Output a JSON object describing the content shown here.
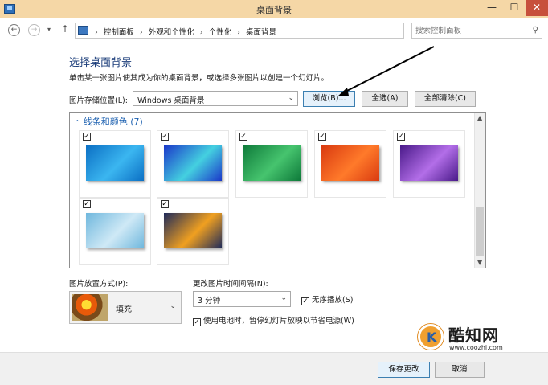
{
  "window": {
    "title": "桌面背景",
    "minimize_glyph": "—",
    "maximize_glyph": "☐",
    "close_glyph": "✕"
  },
  "nav": {
    "back_icon": "left-arrow-icon",
    "forward_icon": "right-arrow-icon",
    "down_glyph": "▾",
    "up_glyph": "↑",
    "breadcrumbs": [
      "控制面板",
      "外观和个性化",
      "个性化",
      "桌面背景"
    ],
    "separator": "›",
    "search_placeholder": "搜索控制面板"
  },
  "content": {
    "heading": "选择桌面背景",
    "subtext": "单击某一张图片使其成为你的桌面背景，或选择多张图片以创建一个幻灯片。",
    "location_label": "图片存储位置(L):",
    "location_value": "Windows 桌面背景",
    "browse_label": "浏览(B)...",
    "select_all_label": "全选(A)",
    "clear_all_label": "全部清除(C)"
  },
  "gallery": {
    "group_title": "线条和颜色 (7)",
    "tiles": [
      {
        "checked": true,
        "colors": [
          "#0b6fc4",
          "#3bb6f0"
        ]
      },
      {
        "checked": true,
        "colors": [
          "#1b38c9",
          "#44d0e0"
        ]
      },
      {
        "checked": true,
        "colors": [
          "#0e7a3a",
          "#46c46e"
        ]
      },
      {
        "checked": true,
        "colors": [
          "#d93a10",
          "#ff7a2a"
        ]
      },
      {
        "checked": true,
        "colors": [
          "#4a1a8a",
          "#b36ee8"
        ]
      },
      {
        "checked": true,
        "colors": [
          "#6fb7dd",
          "#cfe9f6"
        ]
      },
      {
        "checked": true,
        "colors": [
          "#1e2a5a",
          "#f0a020"
        ]
      }
    ],
    "check_glyph": "✓"
  },
  "options": {
    "position_label": "图片放置方式(P):",
    "position_value": "填充",
    "interval_label": "更改图片时间间隔(N):",
    "interval_value": "3 分钟",
    "shuffle_label": "无序播放(S)",
    "shuffle_checked": true,
    "battery_label": "使用电池时，暂停幻灯片放映以节省电源(W)",
    "battery_checked": true
  },
  "footer": {
    "save_label": "保存更改",
    "cancel_label": "取消"
  },
  "watermark": {
    "name": "酷知网",
    "url": "www.coozhi.com"
  }
}
